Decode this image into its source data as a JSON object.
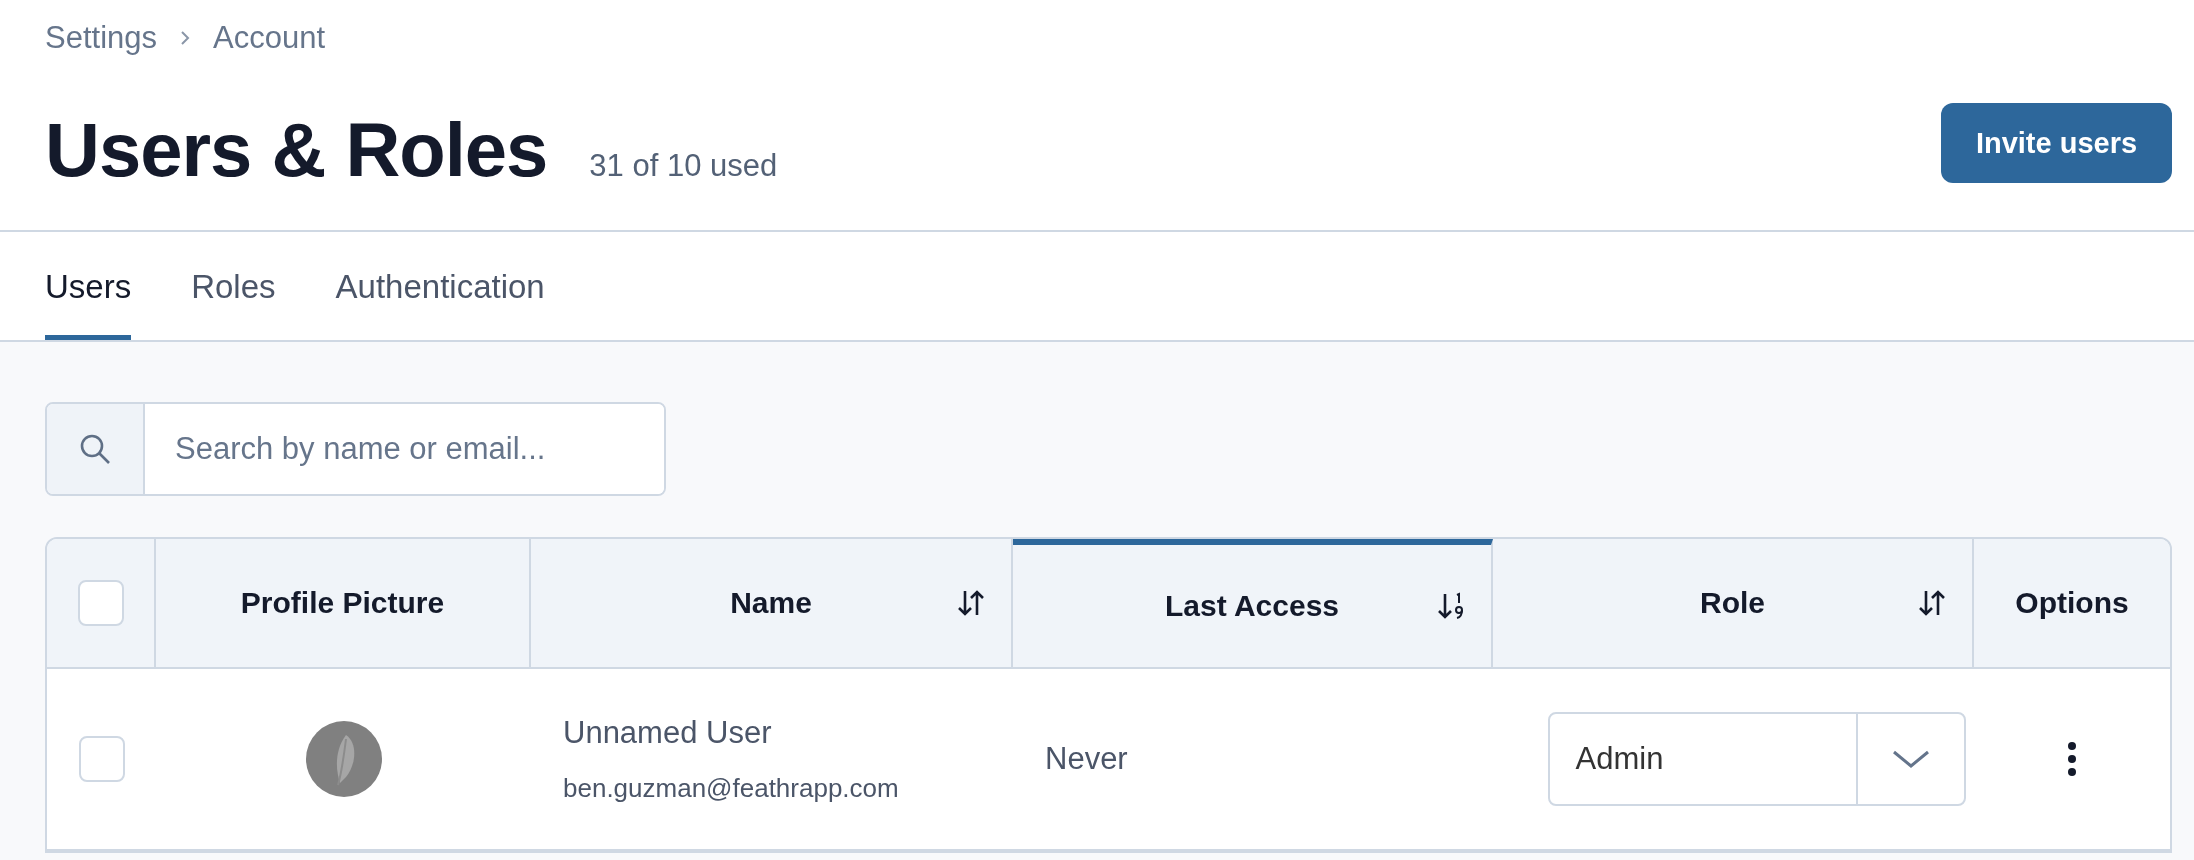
{
  "breadcrumb": [
    {
      "label": "Settings"
    },
    {
      "label": "Account"
    }
  ],
  "page": {
    "title": "Users & Roles",
    "usage": "31 of 10 used",
    "action": "Invite users"
  },
  "tabs": [
    {
      "label": "Users",
      "selected": true
    },
    {
      "label": "Roles",
      "selected": false
    },
    {
      "label": "Authentication",
      "selected": false
    }
  ],
  "search": {
    "placeholder": "Search by name or email..."
  },
  "table": {
    "select_all": {
      "checked": false
    },
    "columns": [
      {
        "label": "Profile Picture",
        "kind": "plain",
        "sorted": false
      },
      {
        "label": "Name",
        "kind": "sortable",
        "sorted": false
      },
      {
        "label": "Last Access",
        "kind": "numeric",
        "sorted": true
      },
      {
        "label": "Role",
        "kind": "sortable",
        "sorted": false
      },
      {
        "label": "Options",
        "kind": "plain",
        "sorted": false
      }
    ],
    "rows": [
      {
        "checked": false,
        "name": "Unnamed User",
        "email": "ben.guzman@feathrapp.com",
        "last_access": "Never",
        "role": "Admin"
      }
    ]
  }
}
